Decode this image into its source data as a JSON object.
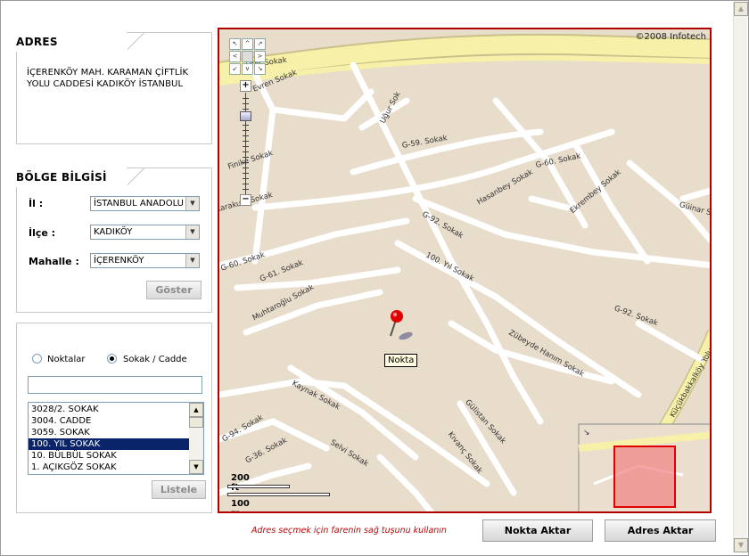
{
  "address_panel": {
    "title": "ADRES",
    "text": "İÇERENKÖY MAH. KARAMAN ÇİFTLİK YOLU CADDESİ KADIKÖY İSTANBUL"
  },
  "region_panel": {
    "title": "BÖLGE BİLGİSİ",
    "il_label": "İl :",
    "il_value": "İSTANBUL ANADOLU",
    "ilce_label": "İlçe :",
    "ilce_value": "KADIKÖY",
    "mahalle_label": "Mahalle :",
    "mahalle_value": "İÇERENKÖY",
    "show_button": "Göster"
  },
  "search_panel": {
    "radio_points": "Noktalar",
    "radio_streets": "Sokak / Cadde",
    "selected_radio": "Sokak / Cadde",
    "search_value": "",
    "list_items": [
      "3028/2. SOKAK",
      "3004. CADDE",
      "3059. SOKAK",
      "100. YIL SOKAK",
      "10. BÜLBÜL SOKAK",
      "1. AÇIKGÖZ SOKAK"
    ],
    "selected_item": "100. YIL SOKAK",
    "list_button": "Listele"
  },
  "map": {
    "copyright": "©2008 Infotech",
    "marker_label": "Nokta",
    "scale_ft": "200 ft",
    "scale_m": "100 m",
    "streets": [
      "Ufer Sokak",
      "Evren Sokak",
      "Uğur Sok",
      "G-59. Sokak",
      "G-60. Sokak",
      "Finike Sokak",
      "Hasanbey Sokak",
      "Ekrembey Sokak",
      "Güinar S",
      "Karakum Sokak",
      "G-92. Sokak",
      "100. Yıl Sokak",
      "G-60. Sokak",
      "G-61. Sokak",
      "Muhtaroğlu Sokak",
      "G-92. Sokak",
      "Zübeyde Hanım Sokak",
      "Kaynak Sokak",
      "Gülistan Sokak",
      "Kıvanç Sokak",
      "G-94. Sokak",
      "Selvi Sokak",
      "G-36. Sokak",
      "Küçükbakkalköy Yolu C"
    ]
  },
  "footer": {
    "hint": "Adres seçmek için farenin sağ tuşunu kullanın",
    "point_button": "Nokta Aktar",
    "address_button": "Adres Aktar"
  },
  "icons": {
    "map_marker": "map-pin-icon",
    "pan_up": "arrow-up-icon",
    "pan_down": "arrow-down-icon",
    "pan_left": "arrow-left-icon",
    "pan_right": "arrow-right-icon",
    "zoom_in": "plus-icon",
    "zoom_out": "minus-icon"
  },
  "colors": {
    "map_border": "#b00000",
    "hint_text": "#c00000",
    "selection": "#0a246a",
    "map_background": "#e8dccb",
    "major_road": "#f6f0a8"
  }
}
